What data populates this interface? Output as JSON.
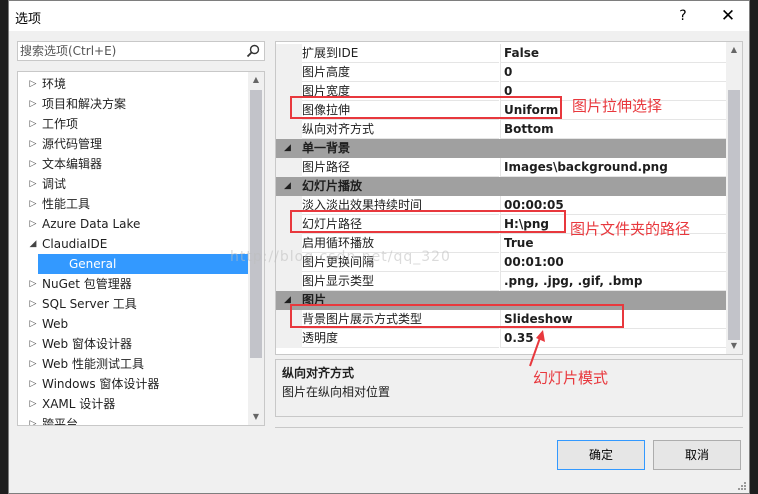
{
  "dialog": {
    "title": "选项",
    "help_label": "?",
    "close_label": "✕"
  },
  "search": {
    "placeholder": "搜索选项(Ctrl+E)"
  },
  "tree": {
    "items": [
      {
        "label": "环境",
        "arrow": "▷"
      },
      {
        "label": "项目和解决方案",
        "arrow": "▷"
      },
      {
        "label": "工作项",
        "arrow": "▷"
      },
      {
        "label": "源代码管理",
        "arrow": "▷"
      },
      {
        "label": "文本编辑器",
        "arrow": "▷"
      },
      {
        "label": "调试",
        "arrow": "▷"
      },
      {
        "label": "性能工具",
        "arrow": "▷"
      },
      {
        "label": "Azure Data Lake",
        "arrow": "▷"
      },
      {
        "label": "ClaudiaIDE",
        "arrow": "◢"
      },
      {
        "label": "General",
        "arrow": ""
      },
      {
        "label": "NuGet 包管理器",
        "arrow": "▷"
      },
      {
        "label": "SQL Server 工具",
        "arrow": "▷"
      },
      {
        "label": "Web",
        "arrow": "▷"
      },
      {
        "label": "Web 窗体设计器",
        "arrow": "▷"
      },
      {
        "label": "Web 性能测试工具",
        "arrow": "▷"
      },
      {
        "label": "Windows 窗体设计器",
        "arrow": "▷"
      },
      {
        "label": "XAML 设计器",
        "arrow": "▷"
      },
      {
        "label": "跨平台",
        "arrow": "▷"
      }
    ]
  },
  "grid": {
    "rows": [
      {
        "kind": "prop",
        "name": "扩展到IDE",
        "value": "False"
      },
      {
        "kind": "prop",
        "name": "图片高度",
        "value": "0"
      },
      {
        "kind": "prop",
        "name": "图片宽度",
        "value": "0"
      },
      {
        "kind": "prop",
        "name": "图像拉伸",
        "value": "Uniform"
      },
      {
        "kind": "prop",
        "name": "纵向对齐方式",
        "value": "Bottom"
      },
      {
        "kind": "cat",
        "name": "单一背景"
      },
      {
        "kind": "prop",
        "name": "图片路径",
        "value": "Images\\background.png"
      },
      {
        "kind": "cat",
        "name": "幻灯片播放"
      },
      {
        "kind": "prop",
        "name": "淡入淡出效果持续时间",
        "value": "00:00:05"
      },
      {
        "kind": "prop",
        "name": "幻灯片路径",
        "value": "H:\\png"
      },
      {
        "kind": "prop",
        "name": "启用循环播放",
        "value": "True"
      },
      {
        "kind": "prop",
        "name": "图片更换间隔",
        "value": "00:01:00"
      },
      {
        "kind": "prop",
        "name": "图片显示类型",
        "value": ".png, .jpg, .gif, .bmp"
      },
      {
        "kind": "cat",
        "name": "图片"
      },
      {
        "kind": "prop",
        "name": "背景图片展示方式类型",
        "value": "Slideshow"
      },
      {
        "kind": "prop",
        "name": "透明度",
        "value": "0.35"
      }
    ]
  },
  "description": {
    "title": "纵向对齐方式",
    "text": "图片在纵向相对位置"
  },
  "buttons": {
    "ok": "确定",
    "cancel": "取消"
  },
  "annotations": {
    "stretch": "图片拉伸选择",
    "folder": "图片文件夹的路径",
    "slideshow": "幻灯片模式",
    "color": "#e8383d"
  },
  "watermark": "http://blog.csdn.net/qq_320"
}
